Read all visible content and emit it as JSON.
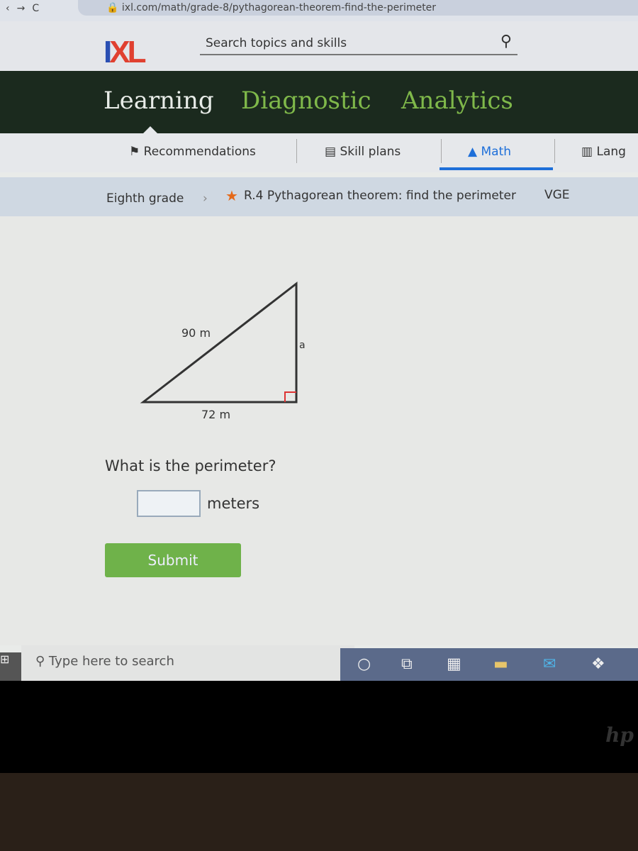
{
  "browser": {
    "url": "ixl.com/math/grade-8/pythagorean-theorem-find-the-perimeter"
  },
  "header": {
    "logo": "IXL",
    "search_placeholder": "Search topics and skills"
  },
  "topnav": [
    {
      "label": "Learning",
      "active": true
    },
    {
      "label": "Diagnostic"
    },
    {
      "label": "Analytics"
    }
  ],
  "subnav": [
    {
      "label": "Recommendations"
    },
    {
      "label": "Skill plans"
    },
    {
      "label": "Math",
      "active": true
    },
    {
      "label": "Lang"
    }
  ],
  "breadcrumb": {
    "grade": "Eighth grade",
    "skill": "R.4 Pythagorean theorem: find the perimeter",
    "code": "VGE"
  },
  "figure": {
    "hypotenuse": "90 m",
    "base": "72 m",
    "side": "a"
  },
  "question": {
    "text": "What is the perimeter?",
    "answer_value": "",
    "unit": "meters",
    "submit": "Submit"
  },
  "taskbar": {
    "search_placeholder": "Type here to search"
  },
  "colors": {
    "nav_bg": "#1b2a1e",
    "nav_active": "#e8ece8",
    "nav_inactive": "#7fb84a",
    "math_accent": "#1e6fd9",
    "submit": "#6fb24a"
  }
}
